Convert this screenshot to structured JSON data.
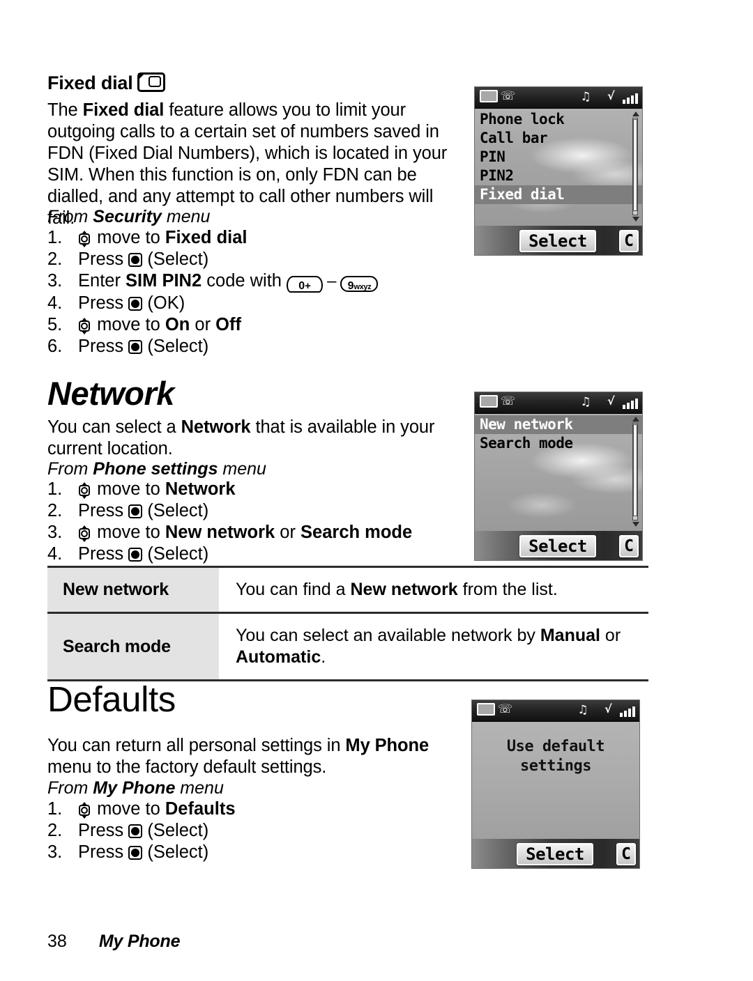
{
  "page": {
    "number": "38",
    "section": "My Phone"
  },
  "sections": {
    "fixed_dial": {
      "heading": "Fixed dial",
      "heading_icon": "sim-card-icon",
      "body": [
        {
          "t": "The "
        },
        {
          "t": "Fixed dial",
          "b": true
        },
        {
          "t": " feature allows you to limit your outgoing calls to a certain set of numbers saved in FDN (Fixed Dial Numbers), which is located in your SIM. When this function is on, only FDN can be dialled, and any attempt to call other numbers will fail."
        }
      ],
      "from_prefix": "From ",
      "from_menu": "Security",
      "from_suffix": " menu",
      "steps": [
        {
          "num": "1.",
          "icon": "nav-key",
          "pre": "",
          "post": " move to ",
          "bold": "Fixed dial",
          "tail": ""
        },
        {
          "num": "2.",
          "icon": "select-key",
          "pre": "Press ",
          "post": " ",
          "bold": "",
          "tail": "(Select)"
        },
        {
          "num": "3.",
          "icon": "keypad-range",
          "pre": "Enter ",
          "bold": "SIM PIN2",
          "post": " code with ",
          "tail": ""
        },
        {
          "num": "4.",
          "icon": "select-key",
          "pre": "Press ",
          "post": " ",
          "bold": "",
          "tail": "(OK)"
        },
        {
          "num": "5.",
          "icon": "nav-key",
          "pre": "",
          "post": " move to ",
          "bold": "On",
          "mid": " or ",
          "bold2": "Off",
          "tail": ""
        },
        {
          "num": "6.",
          "icon": "select-key",
          "pre": "Press ",
          "post": " ",
          "bold": "",
          "tail": "(Select)"
        }
      ],
      "keys": {
        "zero_num": "0",
        "zero_plus": "+",
        "dash": "–",
        "nine_num": "9",
        "nine_letters": "wxyz"
      }
    },
    "network": {
      "heading": "Network",
      "body": [
        {
          "t": "You can select a "
        },
        {
          "t": "Network",
          "b": true
        },
        {
          "t": " that is available in your current location."
        }
      ],
      "from_prefix": "From ",
      "from_menu": "Phone settings",
      "from_suffix": " menu",
      "steps": [
        {
          "num": "1.",
          "icon": "nav-key",
          "pre": "",
          "post": " move to ",
          "bold": "Network",
          "tail": ""
        },
        {
          "num": "2.",
          "icon": "select-key",
          "pre": "Press ",
          "post": " ",
          "bold": "",
          "tail": "(Select)"
        },
        {
          "num": "3.",
          "icon": "nav-key",
          "pre": "",
          "post": " move to ",
          "bold": "New network",
          "mid": " or ",
          "bold2": "Search mode",
          "tail": ""
        },
        {
          "num": "4.",
          "icon": "select-key",
          "pre": "Press ",
          "post": " ",
          "bold": "",
          "tail": "(Select)"
        }
      ],
      "table": [
        {
          "label": "New network",
          "desc": [
            {
              "t": "You can find a "
            },
            {
              "t": "New network",
              "b": true
            },
            {
              "t": " from the list."
            }
          ]
        },
        {
          "label": "Search mode",
          "desc": [
            {
              "t": "You can select an available network by "
            },
            {
              "t": "Manual",
              "b": true
            },
            {
              "t": " or "
            },
            {
              "t": "Automatic",
              "b": true
            },
            {
              "t": "."
            }
          ]
        }
      ]
    },
    "defaults": {
      "heading": "Defaults",
      "body": [
        {
          "t": "You can return all personal settings in "
        },
        {
          "t": "My Phone",
          "b": true
        },
        {
          "t": " menu to the factory default settings."
        }
      ],
      "from_prefix": "From ",
      "from_menu": "My Phone",
      "from_suffix": " menu",
      "steps": [
        {
          "num": "1.",
          "icon": "nav-key",
          "pre": "",
          "post": " move to ",
          "bold": "Defaults",
          "tail": ""
        },
        {
          "num": "2.",
          "icon": "select-key",
          "pre": "Press ",
          "post": " ",
          "bold": "",
          "tail": "(Select)"
        },
        {
          "num": "3.",
          "icon": "select-key",
          "pre": "Press ",
          "post": " ",
          "bold": "",
          "tail": "(Select)"
        }
      ]
    }
  },
  "screenshots": [
    {
      "id": "security-menu",
      "type": "list",
      "items": [
        "Phone lock",
        "Call bar",
        "PIN",
        "PIN2",
        "Fixed dial"
      ],
      "selected_index": 4,
      "scrollbar": true,
      "softkeys": {
        "center": "Select",
        "right": "C"
      },
      "status_icons": [
        "battery-icon",
        "info-icon",
        "ringtone-icon",
        "signal-icon"
      ]
    },
    {
      "id": "network-menu",
      "type": "list",
      "items": [
        "New network",
        "Search mode"
      ],
      "selected_index": 0,
      "scrollbar": true,
      "softkeys": {
        "center": "Select",
        "right": "C"
      },
      "status_icons": [
        "battery-icon",
        "info-icon",
        "ringtone-icon",
        "signal-icon"
      ]
    },
    {
      "id": "defaults-confirm",
      "type": "message",
      "lines": [
        "Use default",
        "settings"
      ],
      "scrollbar": false,
      "softkeys": {
        "center": "Select",
        "right": "C"
      },
      "status_icons": [
        "battery-icon",
        "info-icon",
        "ringtone-icon",
        "signal-icon"
      ]
    }
  ]
}
